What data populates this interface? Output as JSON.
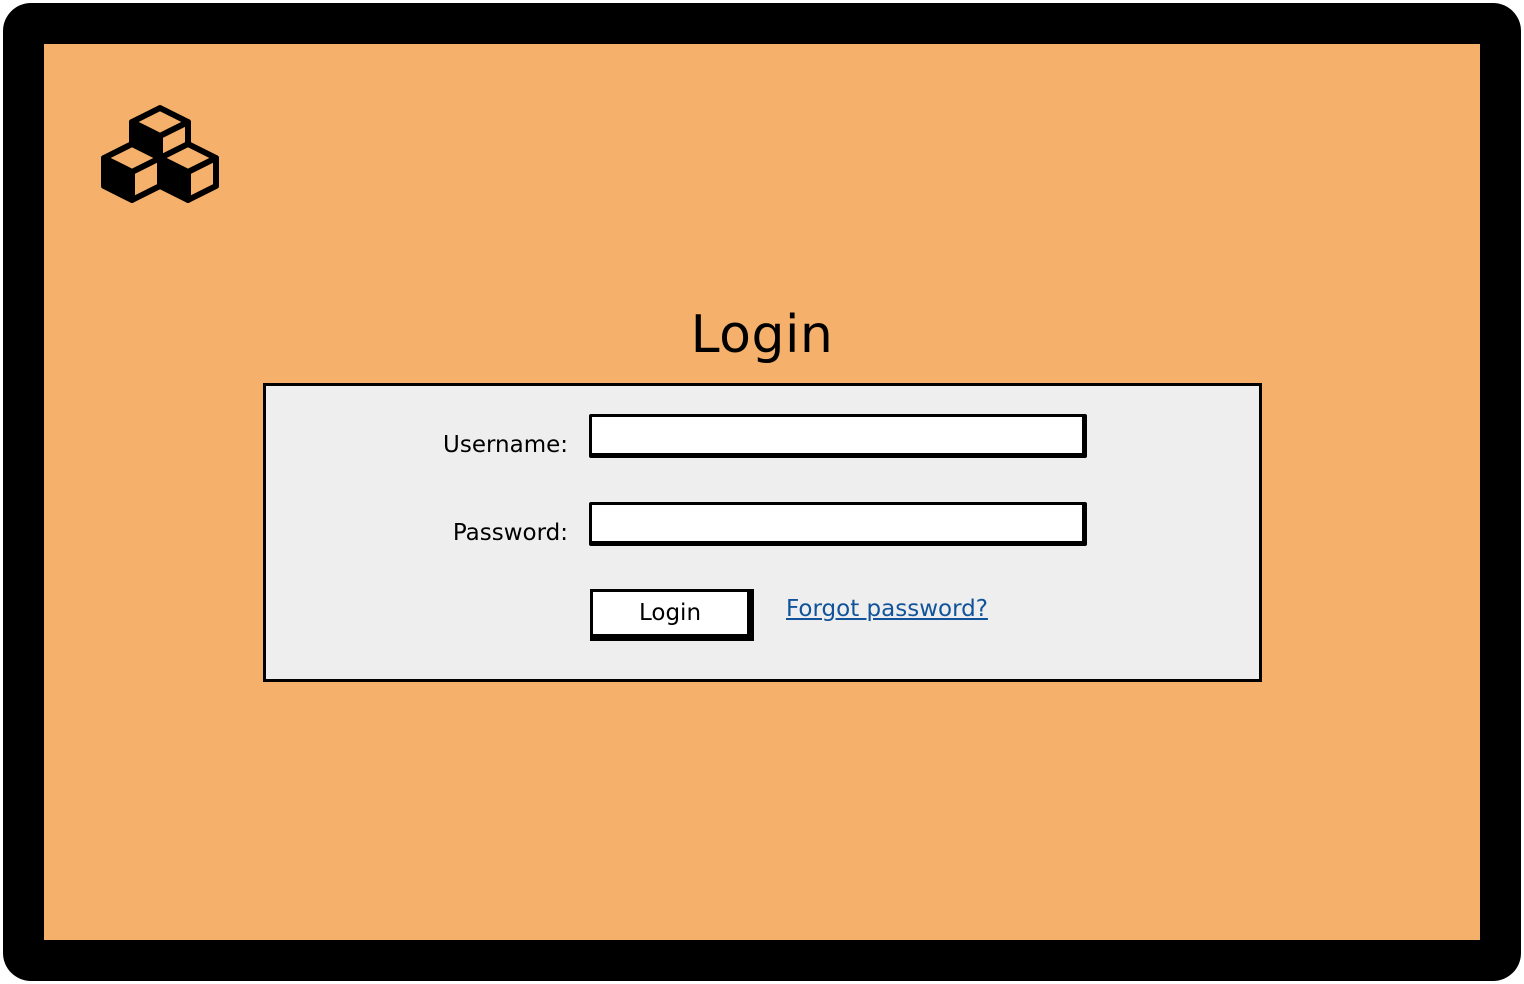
{
  "page": {
    "title": "Login"
  },
  "form": {
    "username_label": "Username:",
    "username_value": "",
    "password_label": "Password:",
    "password_value": "",
    "login_button": "Login",
    "forgot_link": "Forgot password?"
  },
  "logo": {
    "icon": "cubes-icon"
  },
  "colors": {
    "frame": "#000000",
    "screen_background": "#f5b16b",
    "panel_background": "#eeeeee",
    "link": "#10539a"
  }
}
